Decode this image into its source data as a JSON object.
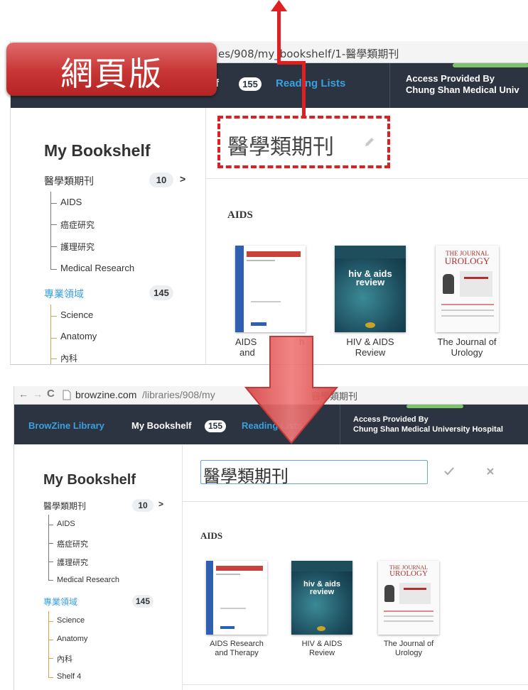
{
  "top": {
    "url_text": "es/908/my_bookshelf/1-醫學類期刊",
    "nav": {
      "shelf_partial": "f",
      "count": "155",
      "reading_lists": "Reading Lists",
      "access_line1": "Access Provided By",
      "access_line2": "Chung Shan Medical Univ"
    },
    "shelf_title": "醫學類期刊",
    "sidebar": {
      "title": "My Bookshelf",
      "shelf1": {
        "label": "醫學類期刊",
        "count": "10",
        "chevron": ">"
      },
      "shelf1_children": [
        "AIDS",
        "癌症研究",
        "護理研究",
        "Medical Research"
      ],
      "shelf2": {
        "label": "專業領域",
        "count": "145"
      },
      "shelf2_children": [
        "Science",
        "Anatomy",
        "內科"
      ]
    },
    "section_label": "AIDS",
    "journals": [
      {
        "caption": "AIDS Research and Therapy",
        "caption_l1": "AIDS",
        "caption_l2": "and",
        "caption_r1": "h"
      },
      {
        "caption": "HIV & AIDS Review",
        "caption_l1": "HIV & AIDS",
        "caption_l2": "Review"
      },
      {
        "caption": "The Journal of Urology",
        "caption_l1": "The Journal of",
        "caption_l2": "Urology"
      }
    ]
  },
  "callout": {
    "label": "網頁版",
    "color": "#c83535"
  },
  "bottom": {
    "url_host": "browzine.com",
    "url_path": "/libraries/908/my",
    "url_tail": "醫學類期刊",
    "nav": {
      "library": "BrowZine Library",
      "bookshelf": "My Bookshelf",
      "count": "155",
      "reading_lists": "Reading Lists",
      "access_line1": "Access Provided By",
      "access_line2": "Chung Shan Medical University Hospital"
    },
    "edit_input_value": "醫學類期刊",
    "sidebar": {
      "title": "My Bookshelf",
      "shelf1": {
        "label": "醫學類期刊",
        "count": "10",
        "chevron": ">"
      },
      "shelf1_children": [
        "AIDS",
        "癌症研究",
        "護理研究",
        "Medical Research"
      ],
      "shelf2": {
        "label": "專業領域",
        "count": "145"
      },
      "shelf2_children": [
        "Science",
        "Anatomy",
        "內科",
        "Shelf 4"
      ]
    },
    "section_label": "AIDS",
    "journals": [
      {
        "caption_l1": "AIDS Research",
        "caption_l2": "and Therapy"
      },
      {
        "caption_l1": "HIV & AIDS",
        "caption_l2": "Review"
      },
      {
        "caption_l1": "The Journal of",
        "caption_l2": "Urology"
      }
    ]
  },
  "colors": {
    "nav_bg": "#2b3440",
    "link_blue": "#3aa0e0",
    "annotation_red": "#e02020",
    "arrow_red": "#e25b5b",
    "tree_orange": "#d8a24a"
  },
  "icons": [
    "pencil-icon",
    "check-icon",
    "close-icon",
    "back-icon",
    "forward-icon",
    "reload-icon",
    "page-icon",
    "chevron-right-icon"
  ]
}
